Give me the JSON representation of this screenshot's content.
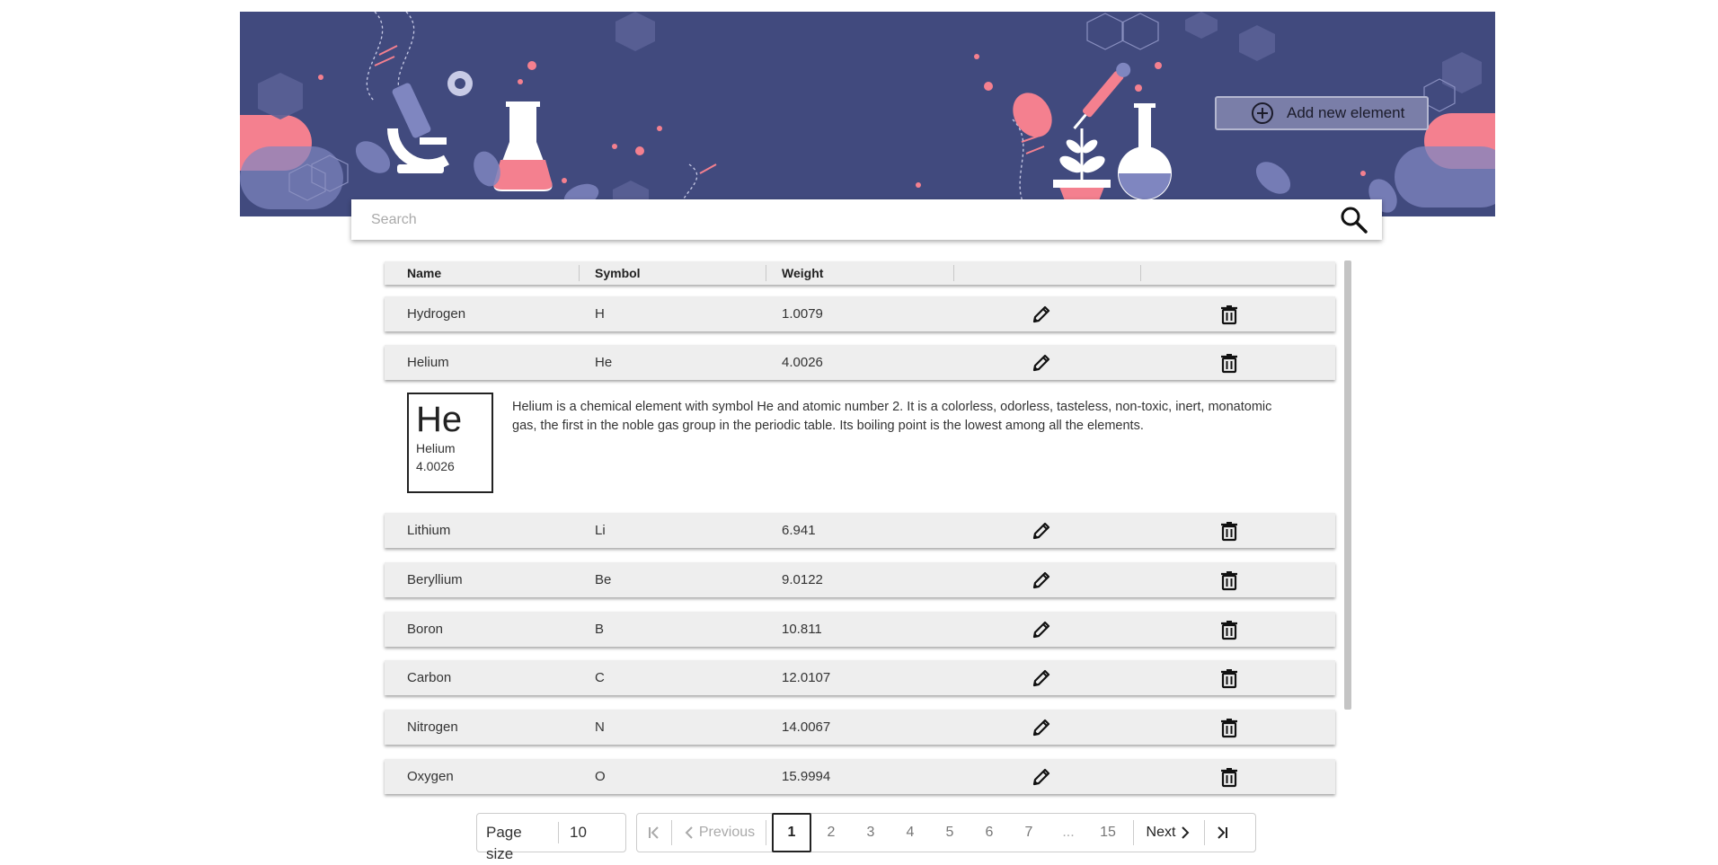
{
  "header": {
    "add_button_label": "Add new element"
  },
  "search": {
    "placeholder": "Search"
  },
  "table": {
    "columns": [
      "Name",
      "Symbol",
      "Weight",
      "",
      ""
    ],
    "rows": [
      {
        "name": "Hydrogen",
        "symbol": "H",
        "weight": "1.0079"
      },
      {
        "name": "Helium",
        "symbol": "He",
        "weight": "4.0026"
      },
      {
        "name": "Lithium",
        "symbol": "Li",
        "weight": "6.941"
      },
      {
        "name": "Beryllium",
        "symbol": "Be",
        "weight": "9.0122"
      },
      {
        "name": "Boron",
        "symbol": "B",
        "weight": "10.811"
      },
      {
        "name": "Carbon",
        "symbol": "C",
        "weight": "12.0107"
      },
      {
        "name": "Nitrogen",
        "symbol": "N",
        "weight": "14.0067"
      },
      {
        "name": "Oxygen",
        "symbol": "O",
        "weight": "15.9994"
      }
    ],
    "expanded": {
      "symbol": "He",
      "name": "Helium",
      "weight": "4.0026",
      "description": "Helium is a chemical element with symbol He and atomic number 2. It is a colorless, odorless, tasteless, non-toxic, inert, monatomic gas, the first in the noble gas group in the periodic table. Its boiling point is the lowest among all the elements."
    },
    "row_icons": [
      "pencil-icon",
      "trash-icon"
    ]
  },
  "pagination": {
    "page_size_label": "Page size",
    "page_size_value": "10",
    "previous_label": "Previous",
    "next_label": "Next",
    "pages": [
      "1",
      "2",
      "3",
      "4",
      "5",
      "6",
      "7",
      "...",
      "15"
    ],
    "current_page": "1"
  },
  "colors": {
    "banner": "#414a7e",
    "accent_pink": "#f4808f",
    "row_bg": "#eeeeee"
  }
}
